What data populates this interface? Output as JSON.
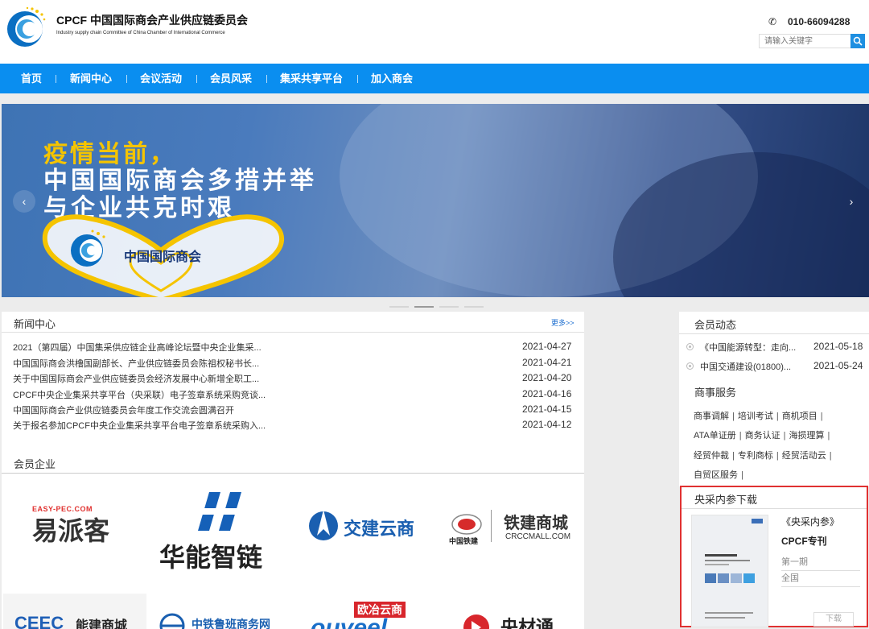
{
  "header": {
    "site_title": "CPCF 中国国际商会产业供应链委员会",
    "site_subtitle": "Industry supply chain Committee of China Chamber of International Commerce",
    "phone": "010-66094288",
    "search_placeholder": "请输入关键字"
  },
  "nav": {
    "items": [
      {
        "label": "首页"
      },
      {
        "label": "新闻中心"
      },
      {
        "label": "会议活动"
      },
      {
        "label": "会员风采"
      },
      {
        "label": "集采共享平台"
      },
      {
        "label": "加入商会"
      }
    ]
  },
  "banner": {
    "line1": "疫情当前，",
    "line2": "中国国际商会多措并举",
    "line3": "与企业共克时艰",
    "badge_text": "中国国际商会",
    "prev_arrow": "‹",
    "next_arrow": "›"
  },
  "news": {
    "title": "新闻中心",
    "more": "更多>>",
    "items": [
      {
        "title": "2021（第四届）中国集采供应链企业高峰论坛暨中央企业集采...",
        "date": "2021-04-27"
      },
      {
        "title": "中国国际商会洪橹国副部长、产业供应链委员会陈祖权秘书长...",
        "date": "2021-04-21"
      },
      {
        "title": "关于中国国际商会产业供应链委员会经济发展中心新增全职工...",
        "date": "2021-04-20"
      },
      {
        "title": "CPCF中央企业集采共享平台（央采联）电子签章系统采购竞谈...",
        "date": "2021-04-16"
      },
      {
        "title": "中国国际商会产业供应链委员会年度工作交流会圆满召开",
        "date": "2021-04-15"
      },
      {
        "title": "关于报名参加CPCF中央企业集采共享平台电子签章系统采购入...",
        "date": "2021-04-12"
      }
    ]
  },
  "members": {
    "title": "会员企业",
    "logos": [
      {
        "top": "EASY-PEC.COM",
        "main": "易派客"
      },
      {
        "main": "华能智链"
      },
      {
        "main": "交建云商"
      },
      {
        "cn": "中国铁建",
        "main": "铁建商城",
        "sub": "CRCCMALL.COM"
      },
      {
        "main": "能建商城"
      },
      {
        "main": "中铁鲁班商务网"
      },
      {
        "top": "欧冶云商"
      },
      {
        "main": "央材通"
      }
    ]
  },
  "member_news": {
    "title": "会员动态",
    "items": [
      {
        "title": "《中国能源转型：走向...",
        "date": "2021-05-18"
      },
      {
        "title": "中国交通建设(01800)...",
        "date": "2021-05-24"
      }
    ]
  },
  "services": {
    "title": "商事服务",
    "lines": [
      [
        "商事调解",
        "培训考试",
        "商机项目"
      ],
      [
        "ATA单证册",
        "商务认证",
        "海损理算"
      ],
      [
        "经贸仲裁",
        "专利商标",
        "经贸活动云"
      ],
      [
        "自贸区服务"
      ]
    ]
  },
  "download": {
    "title": "央采内参下载",
    "name": "《央采内参》",
    "subtitle": "CPCF专刊",
    "issue": "第一期",
    "scope": "全国",
    "button": "下载"
  },
  "colors": {
    "nav_blue": "#0a8ef0",
    "banner_yellow": "#f5c400",
    "highlight_red": "#e03131"
  }
}
